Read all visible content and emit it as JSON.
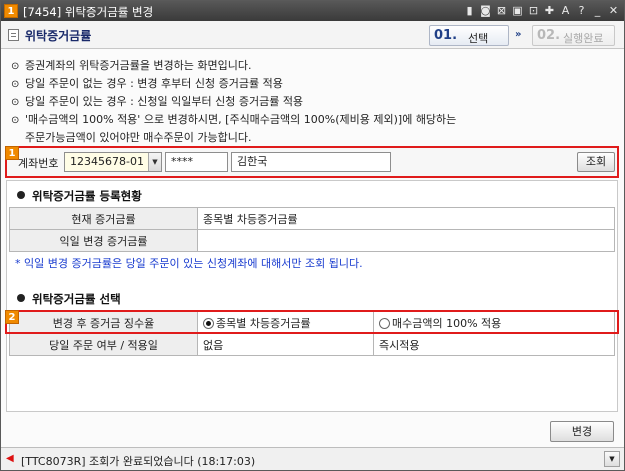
{
  "window": {
    "number_badge": "1",
    "title": "[7454] 위탁증거금률 변경",
    "title_icons": [
      "pin-icon",
      "lock-icon",
      "grid-icon",
      "table-icon",
      "link-icon",
      "tool-icon",
      "text-size-icon",
      "help-icon",
      "minimize-icon",
      "close-icon"
    ]
  },
  "header": {
    "title": "위탁증거금률",
    "step1": {
      "num": "01.",
      "label": "선택"
    },
    "step_arrow": "»",
    "step2": {
      "num": "02.",
      "label": "실행완료"
    }
  },
  "info": {
    "bullet": "⊙",
    "lines": [
      "증권계좌의 위탁증거금률을 변경하는 화면입니다.",
      "당일 주문이 없는 경우 : 변경 후부터 신청 증거금률 적용",
      "당일 주문이 있는 경우 : 신청일 익일부터 신청 증거금률 적용",
      "'매수금액의 100% 적용' 으로 변경하시면, [주식매수금액의 100%(제비용 제외)]에 해당하는"
    ],
    "continuation": "주문가능금액이 있어야만 매수주문이 가능합니다."
  },
  "highlights": {
    "tag1": "1",
    "tag2": "2"
  },
  "account": {
    "label": "계좌번호",
    "number": "12345678-01",
    "password": "****",
    "name": "김한국",
    "search_button": "조회"
  },
  "status_section": {
    "title": "위탁증거금률 등록현황",
    "rows": [
      {
        "label": "현재 증거금률",
        "value": "종목별 차등증거금률"
      },
      {
        "label": "익일 변경 증거금률",
        "value": ""
      }
    ],
    "note": "* 익일 변경 증거금률은 당일 주문이 있는 신청계좌에 대해서만 조회 됩니다."
  },
  "select_section": {
    "title": "위탁증거금률 선택",
    "change_label": "변경 후 증거금 징수율",
    "options": [
      {
        "label": "종목별 차등증거금률",
        "selected": true
      },
      {
        "label": "매수금액의 100% 적용",
        "selected": false
      }
    ],
    "order_label": "당일 주문 여부 / 적용일",
    "order_value": "없음",
    "apply_value": "즉시적용"
  },
  "buttons": {
    "change": "변경"
  },
  "statusbar": {
    "message": "[TTC8073R] 조회가 완료되었습니다 (18:17:03)"
  },
  "colors": {
    "highlight_border": "#e01b1b",
    "tag_orange": "#f08a00",
    "note_blue": "#1a3ccf",
    "header_navy": "#1f3f87"
  }
}
